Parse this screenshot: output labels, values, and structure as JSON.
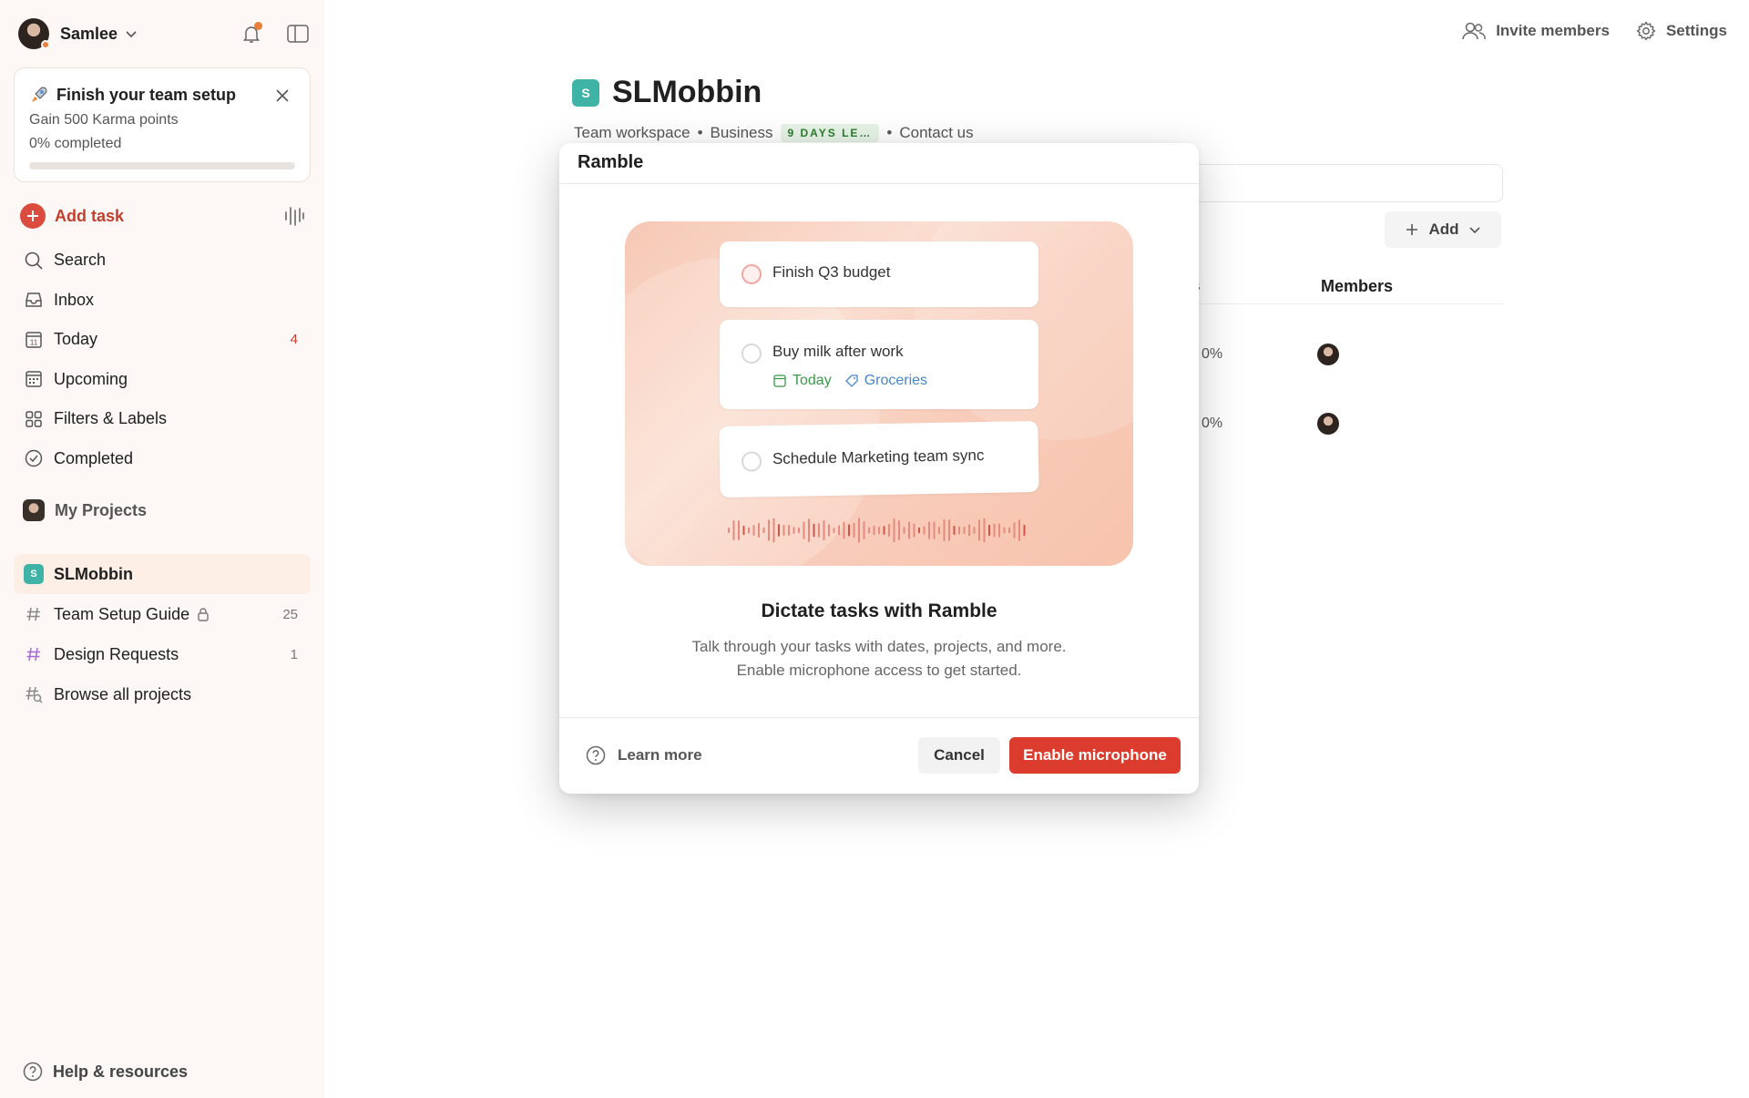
{
  "user": {
    "name": "Samlee"
  },
  "setup": {
    "title": "Finish your team setup",
    "subtitle": "Gain 500 Karma points",
    "progress_text": "0% completed",
    "progress": 0
  },
  "sidebar": {
    "add_task": "Add task",
    "nav": [
      {
        "label": "Search",
        "icon": "search-icon"
      },
      {
        "label": "Inbox",
        "icon": "inbox-icon"
      },
      {
        "label": "Today",
        "icon": "calendar-today-icon",
        "count": "4"
      },
      {
        "label": "Upcoming",
        "icon": "calendar-grid-icon"
      },
      {
        "label": "Filters & Labels",
        "icon": "grid-icon"
      },
      {
        "label": "Completed",
        "icon": "check-circle-icon"
      }
    ],
    "my_projects": "My Projects",
    "projects": [
      {
        "label": "SLMobbin",
        "badge": "S",
        "active": true
      },
      {
        "label": "Team Setup Guide",
        "count": "25",
        "locked": true
      },
      {
        "label": "Design Requests",
        "count": "1"
      },
      {
        "label": "Browse all projects"
      }
    ],
    "help": "Help & resources"
  },
  "header": {
    "invite": "Invite members",
    "settings": "Settings"
  },
  "workspace": {
    "badge": "S",
    "title": "SLMobbin",
    "type": "Team workspace",
    "plan": "Business",
    "trial": "9 DAYS LE…",
    "contact": "Contact us",
    "add_label": "Add",
    "col_partial": "s",
    "col_members": "Members",
    "rows": [
      {
        "pct": "0%"
      },
      {
        "pct": "0%"
      }
    ]
  },
  "modal": {
    "title": "Ramble",
    "tasks": [
      {
        "text": "Finish Q3 budget"
      },
      {
        "text": "Buy milk after work",
        "date": "Today",
        "label": "Groceries"
      },
      {
        "text": "Schedule Marketing team sync"
      }
    ],
    "heading": "Dictate tasks with Ramble",
    "body": "Talk through your tasks with dates, projects, and more. Enable microphone access to get started.",
    "learn_more": "Learn more",
    "cancel": "Cancel",
    "enable": "Enable microphone"
  },
  "colors": {
    "accent": "#dc4c3e",
    "sidebar_bg": "#fdf8f5",
    "workspace_badge": "#3fb3a6",
    "trial_bg": "#e7f3e6"
  }
}
